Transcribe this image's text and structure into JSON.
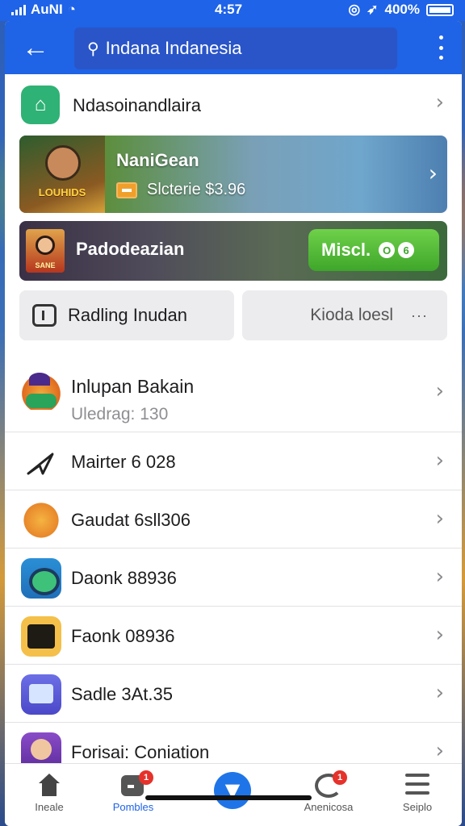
{
  "status": {
    "carrier": "AuNI",
    "time": "4:57",
    "battery": "400%"
  },
  "appbar": {
    "search_value": "Indana Indanesia"
  },
  "top_row": {
    "label": "Ndasoinandlaira"
  },
  "banner1": {
    "title": "NaniGean",
    "subtitle": "Slcterie $3.96",
    "art_text": "LOUHIDS"
  },
  "banner2": {
    "title": "Padodeazian",
    "button_label": "Miscl.",
    "button_glyph_1": "O",
    "button_glyph_2": "6",
    "art_text": "SANE"
  },
  "chips": {
    "left_label": "Radling Inudan",
    "right_label": "Kioda loesl",
    "right_more": "···"
  },
  "list": [
    {
      "title": "Inlupan Bakain",
      "subtitle": "Uledrag: 130",
      "icon": "character-icon"
    },
    {
      "title": "Mairter 6 028",
      "icon": "send-icon"
    },
    {
      "title": "Gaudat 6sll306",
      "icon": "sun-creature-icon"
    },
    {
      "title": "Daonk 88936",
      "icon": "gem-icon"
    },
    {
      "title": "Faonk 08936",
      "icon": "chest-icon"
    },
    {
      "title": "Sadle 3At.35",
      "icon": "screen-icon"
    },
    {
      "title": "Forisai: Coniation",
      "icon": "portrait-icon"
    }
  ],
  "tabs": [
    {
      "label": "Ineale",
      "icon": "home-icon"
    },
    {
      "label": "Pombles",
      "icon": "games-icon",
      "badge": "1"
    },
    {
      "label": "",
      "icon": "download-icon"
    },
    {
      "label": "Anenicosa",
      "icon": "update-icon",
      "badge": "1"
    },
    {
      "label": "Seiplo",
      "icon": "menu-icon"
    }
  ],
  "colors": {
    "primary": "#1f63e6",
    "accent_green": "#3ea62a",
    "badge_red": "#e5322b"
  }
}
